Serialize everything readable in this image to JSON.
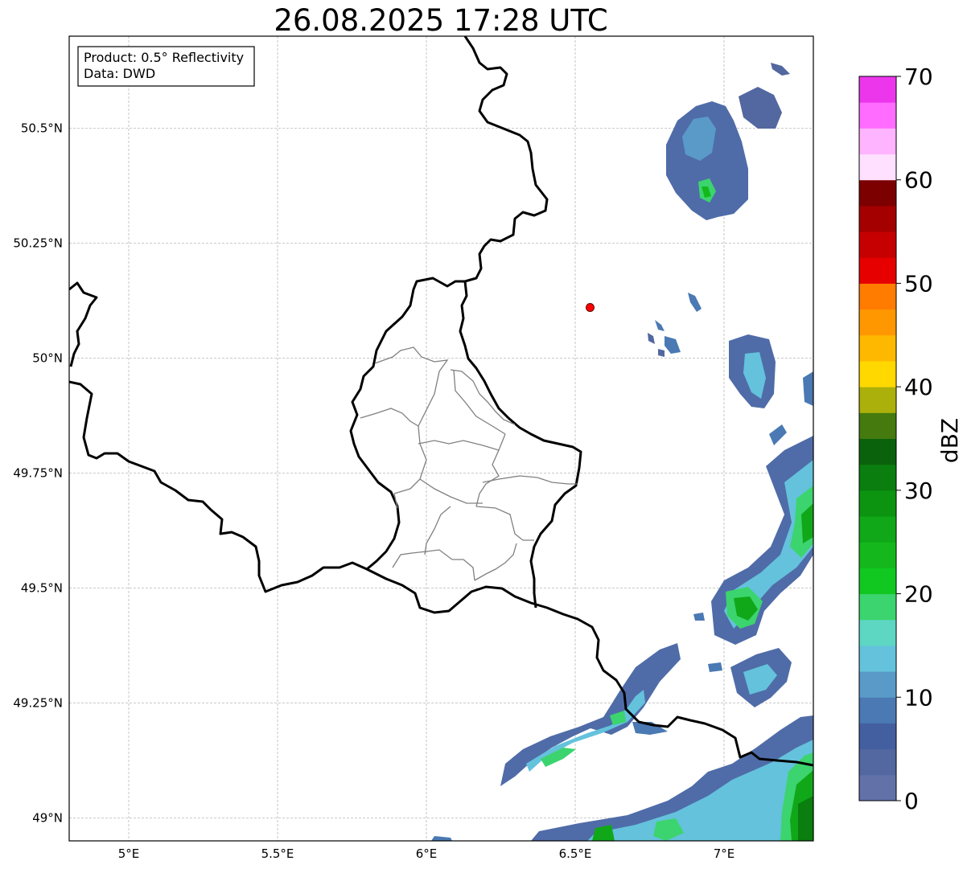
{
  "title": "26.08.2025 17:28 UTC",
  "info_box": {
    "line1": "Product: 0.5° Reflectivity",
    "line2": "Data: DWD"
  },
  "map": {
    "lon_range": [
      4.8,
      7.3
    ],
    "lat_range": [
      48.95,
      50.7
    ],
    "lon_ticks": [
      5.0,
      5.5,
      6.0,
      6.5,
      7.0
    ],
    "lon_tick_labels": [
      "5°E",
      "5.5°E",
      "6°E",
      "6.5°E",
      "7°E"
    ],
    "lat_ticks": [
      50.5,
      50.25,
      50.0,
      49.75,
      49.5,
      49.25,
      49.0
    ],
    "lat_tick_labels": [
      "50.5°N",
      "50.25°N",
      "50°N",
      "49.75°N",
      "49.5°N",
      "49.25°N",
      "49°N"
    ],
    "grid": true,
    "radar_site": {
      "lon": 6.55,
      "lat": 50.11,
      "color": "#ff0000"
    }
  },
  "colorbar": {
    "label": "dBZ",
    "min": 0,
    "max": 70,
    "tick_values": [
      0,
      10,
      20,
      30,
      40,
      50,
      60,
      70
    ],
    "tick_labels": [
      "0",
      "10",
      "20",
      "30",
      "40",
      "50",
      "60",
      "70"
    ],
    "colors": [
      "#6272a8",
      "#5367a0",
      "#445fa0",
      "#4a79b3",
      "#5a9ac8",
      "#64c2dc",
      "#5dd6c2",
      "#3cd46e",
      "#10c820",
      "#14b81c",
      "#10a818",
      "#0c9410",
      "#0a7e0e",
      "#0a620c",
      "#447a0e",
      "#acb00a",
      "#ffd800",
      "#ffb800",
      "#ff9800",
      "#ff7c00",
      "#e60000",
      "#c60000",
      "#a40000",
      "#7c0000",
      "#ffe0ff",
      "#ffb4ff",
      "#ff6cff",
      "#ec36ec"
    ]
  }
}
